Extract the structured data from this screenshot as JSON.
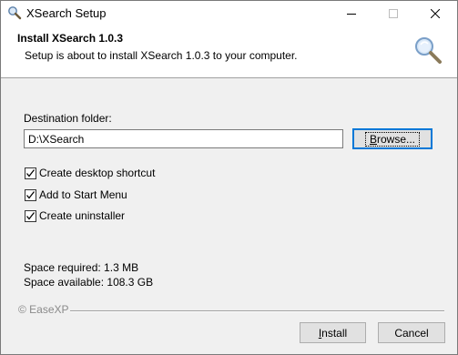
{
  "window": {
    "title": "XSearch Setup",
    "icon": "search-magnifier-icon"
  },
  "header": {
    "title": "Install XSearch 1.0.3",
    "subtitle": "Setup is about to install XSearch 1.0.3 to your computer.",
    "icon": "magnifier-icon"
  },
  "destination": {
    "label": "Destination folder:",
    "value": "D:\\XSearch",
    "browse_label_prefix": "B",
    "browse_label_rest": "rowse..."
  },
  "options": [
    {
      "label": "Create desktop shortcut",
      "checked": true
    },
    {
      "label": "Add to Start Menu",
      "checked": true
    },
    {
      "label": "Create uninstaller",
      "checked": true
    }
  ],
  "space": {
    "required": "Space required: 1.3 MB",
    "available": "Space available: 108.3 GB"
  },
  "footer": {
    "brand": "© EaseXP",
    "install_prefix": "I",
    "install_rest": "nstall",
    "cancel": "Cancel"
  }
}
